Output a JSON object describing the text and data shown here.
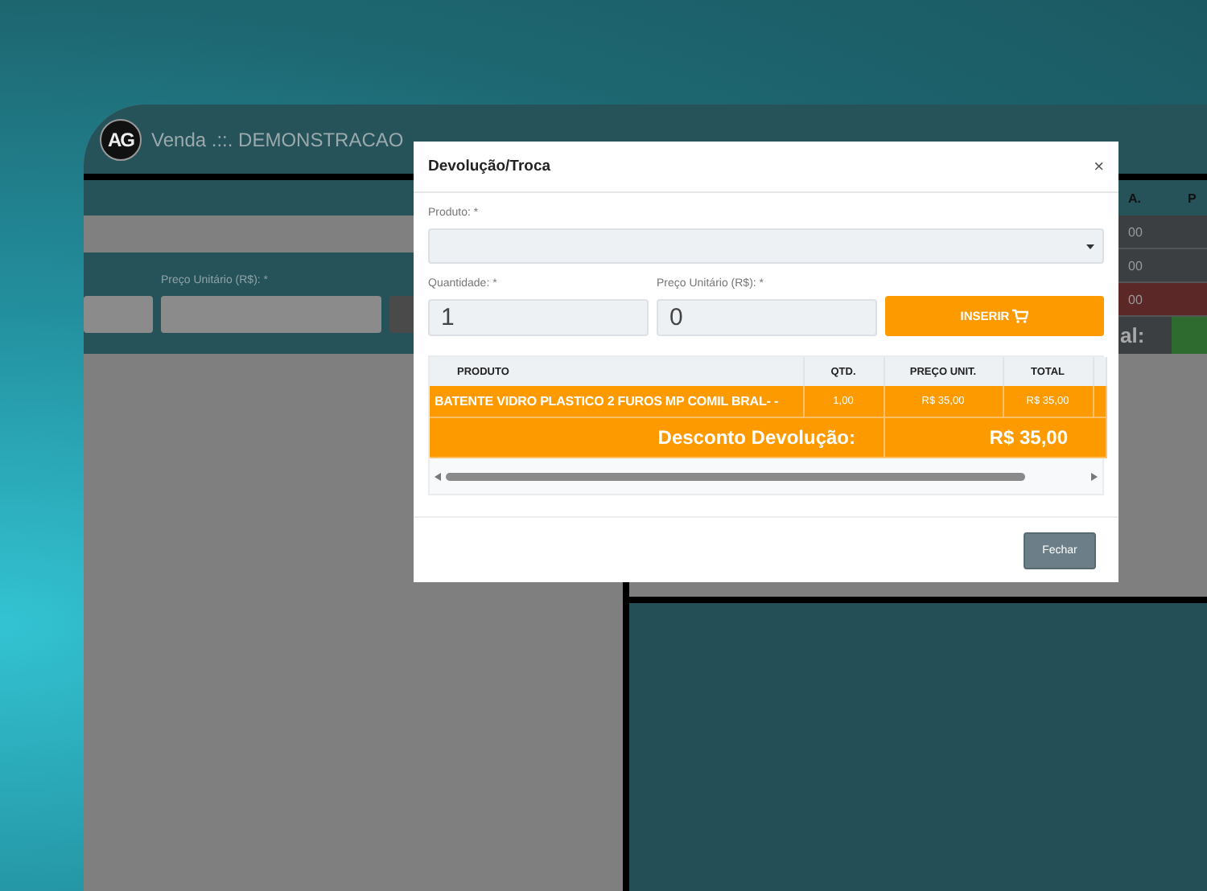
{
  "window": {
    "logo": "AG",
    "title": "Venda .::. DEMONSTRACAO"
  },
  "form": {
    "price_label": "Preço Unitário (R$): *"
  },
  "side_table": {
    "columns": [
      "A.",
      "P"
    ],
    "rows": [
      {
        "cell": "00",
        "color": "#3c3f42"
      },
      {
        "cell": "00",
        "color": "#3c3f42"
      },
      {
        "cell": "00",
        "color": "#5b2727"
      }
    ],
    "total_label": "al:"
  },
  "dialog": {
    "title": "Devolução/Troca",
    "close": "×",
    "product_label": "Produto: *",
    "quantity_label": "Quantidade: *",
    "quantity": "1",
    "price_label": "Preço Unitário (R$): *",
    "price": "0",
    "insert_button": "INSERIR",
    "columns": [
      "PRODUTO",
      "QTD.",
      "PREÇO UNIT.",
      "TOTAL"
    ],
    "rows": [
      {
        "product": "BATENTE VIDRO PLASTICO 2 FUROS MP COMIL BRAL- -",
        "qty": "1,00",
        "unit_price": "R$ 35,00",
        "total": "R$ 35,00"
      }
    ],
    "summary_label": "Desconto Devolução:",
    "summary_value": "R$ 35,00",
    "buttons": [
      "Fechar"
    ]
  }
}
